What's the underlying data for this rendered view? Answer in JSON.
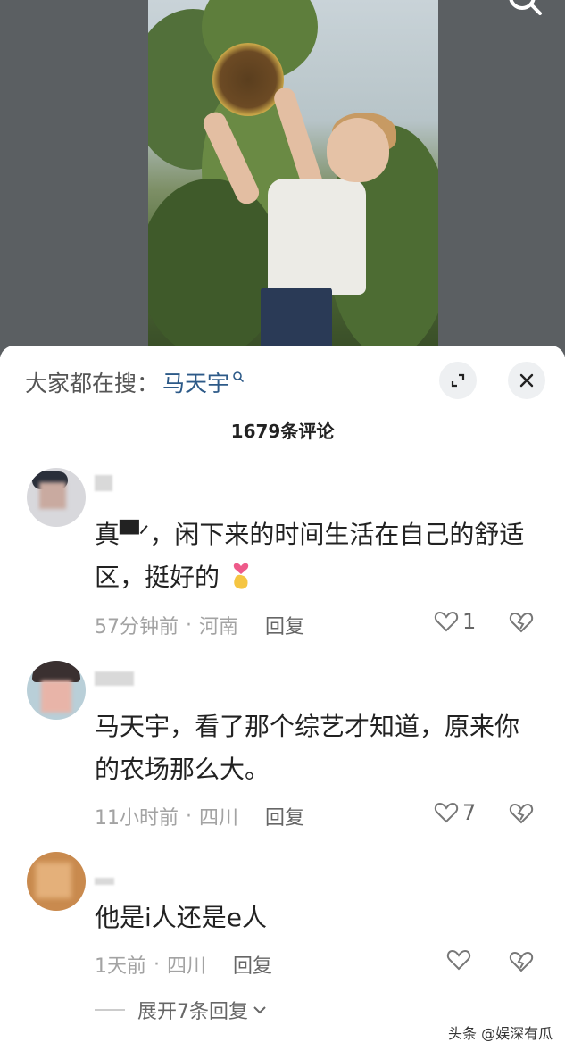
{
  "search_hint": {
    "label": "大家都在搜：",
    "term": "马天宇"
  },
  "comment_count": "1679条评论",
  "comments": [
    {
      "text": "真▀ᐟ，闲下来的时间生活在自己的舒适区，挺好的",
      "time": "57分钟前",
      "location": "河南",
      "reply_label": "回复",
      "likes": "1"
    },
    {
      "text": "马天宇，看了那个综艺才知道，原来你的农场那么大。",
      "time": "11小时前",
      "location": "四川",
      "reply_label": "回复",
      "likes": "7"
    },
    {
      "text": "他是i人还是e人",
      "time": "1天前",
      "location": "四川",
      "reply_label": "回复",
      "likes": ""
    }
  ],
  "expand_replies": "展开7条回复",
  "watermark": "头条 @娱深有瓜",
  "colors": {
    "accent_link": "#2d5a88",
    "meta_gray": "#a3a3a3",
    "heart_pink": "#ee5a8a"
  },
  "icons": [
    "search-icon",
    "expand-icon",
    "close-icon",
    "heart-icon",
    "broken-heart-icon",
    "chevron-down-icon",
    "finger-heart-emoji"
  ]
}
